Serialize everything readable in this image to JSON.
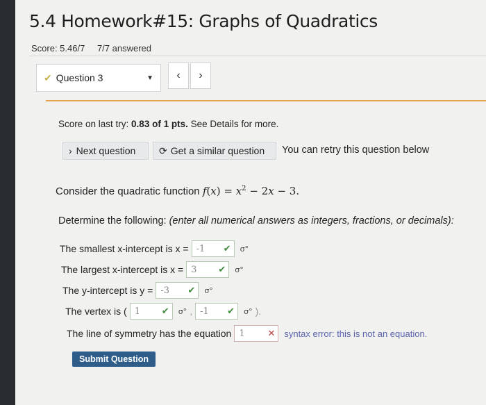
{
  "header": {
    "title": "5.4 Homework#15: Graphs of Quadratics",
    "score": "Score: 5.46/7",
    "answered": "7/7 answered"
  },
  "question_nav": {
    "selected": "Question 3",
    "prev_label": "‹",
    "next_label": "›"
  },
  "last_try": {
    "prefix": "Score on last try: ",
    "value": "0.83 of 1 pts.",
    "suffix": " See Details for more."
  },
  "actions": {
    "next_question": "Next question",
    "similar_question": "Get a similar question",
    "retry_note": "You can retry this question below"
  },
  "problem": {
    "intro": "Consider the quadratic function",
    "instructions_lead": "Determine the following: ",
    "instructions_italic": "(enter all numerical answers as integers, fractions, or decimals):"
  },
  "answers": {
    "smallest_label": "The smallest x-intercept is x =",
    "smallest_value": "-1",
    "largest_label": "The largest x-intercept is x =",
    "largest_value": "3",
    "yint_label": "The y-intercept is y =",
    "yint_value": "-3",
    "vertex_label": "The vertex is (",
    "vertex_x": "1",
    "vertex_y": "-1",
    "symmetry_label": "The line of symmetry has the equation",
    "symmetry_value": "1",
    "symmetry_error": "syntax error: this is not an equation."
  },
  "submit_label": "Submit Question"
}
